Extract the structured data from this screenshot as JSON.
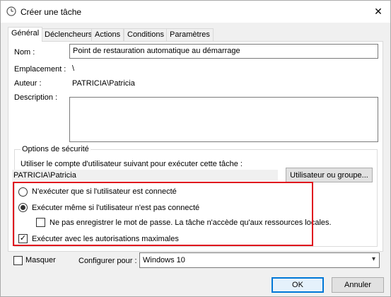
{
  "window": {
    "title": "Créer une tâche",
    "close_glyph": "✕"
  },
  "tabs": [
    {
      "label": "Général"
    },
    {
      "label": "Déclencheurs"
    },
    {
      "label": "Actions"
    },
    {
      "label": "Conditions"
    },
    {
      "label": "Paramètres"
    }
  ],
  "general": {
    "name_label": "Nom :",
    "name_value": "Point de restauration automatique au démarrage",
    "location_label": "Emplacement :",
    "location_value": "\\",
    "author_label": "Auteur :",
    "author_value": "PATRICIA\\Patricia",
    "description_label": "Description :",
    "description_value": ""
  },
  "security": {
    "group_title": "Options de sécurité",
    "account_prompt": "Utiliser le compte d'utilisateur suivant pour exécuter cette tâche :",
    "account_value": "PATRICIA\\Patricia",
    "user_group_button": "Utilisateur ou groupe...",
    "radio_logged_on": "N'exécuter que si l'utilisateur est connecté",
    "radio_logged_on_checked": false,
    "radio_whether_logged": "Exécuter même si l'utilisateur n'est pas connecté",
    "radio_whether_logged_checked": true,
    "no_store_password": "Ne pas enregistrer le mot de passe. La tâche n'accède qu'aux ressources locales.",
    "no_store_password_checked": false,
    "highest_privileges": "Exécuter avec les autorisations maximales",
    "highest_privileges_checked": true
  },
  "footer": {
    "hidden_label": "Masquer",
    "hidden_checked": false,
    "configure_label": "Configurer pour :",
    "configure_value": "Windows 10",
    "ok_button": "OK",
    "cancel_button": "Annuler"
  },
  "colors": {
    "highlight": "#e0141e",
    "accent": "#0078d7"
  }
}
